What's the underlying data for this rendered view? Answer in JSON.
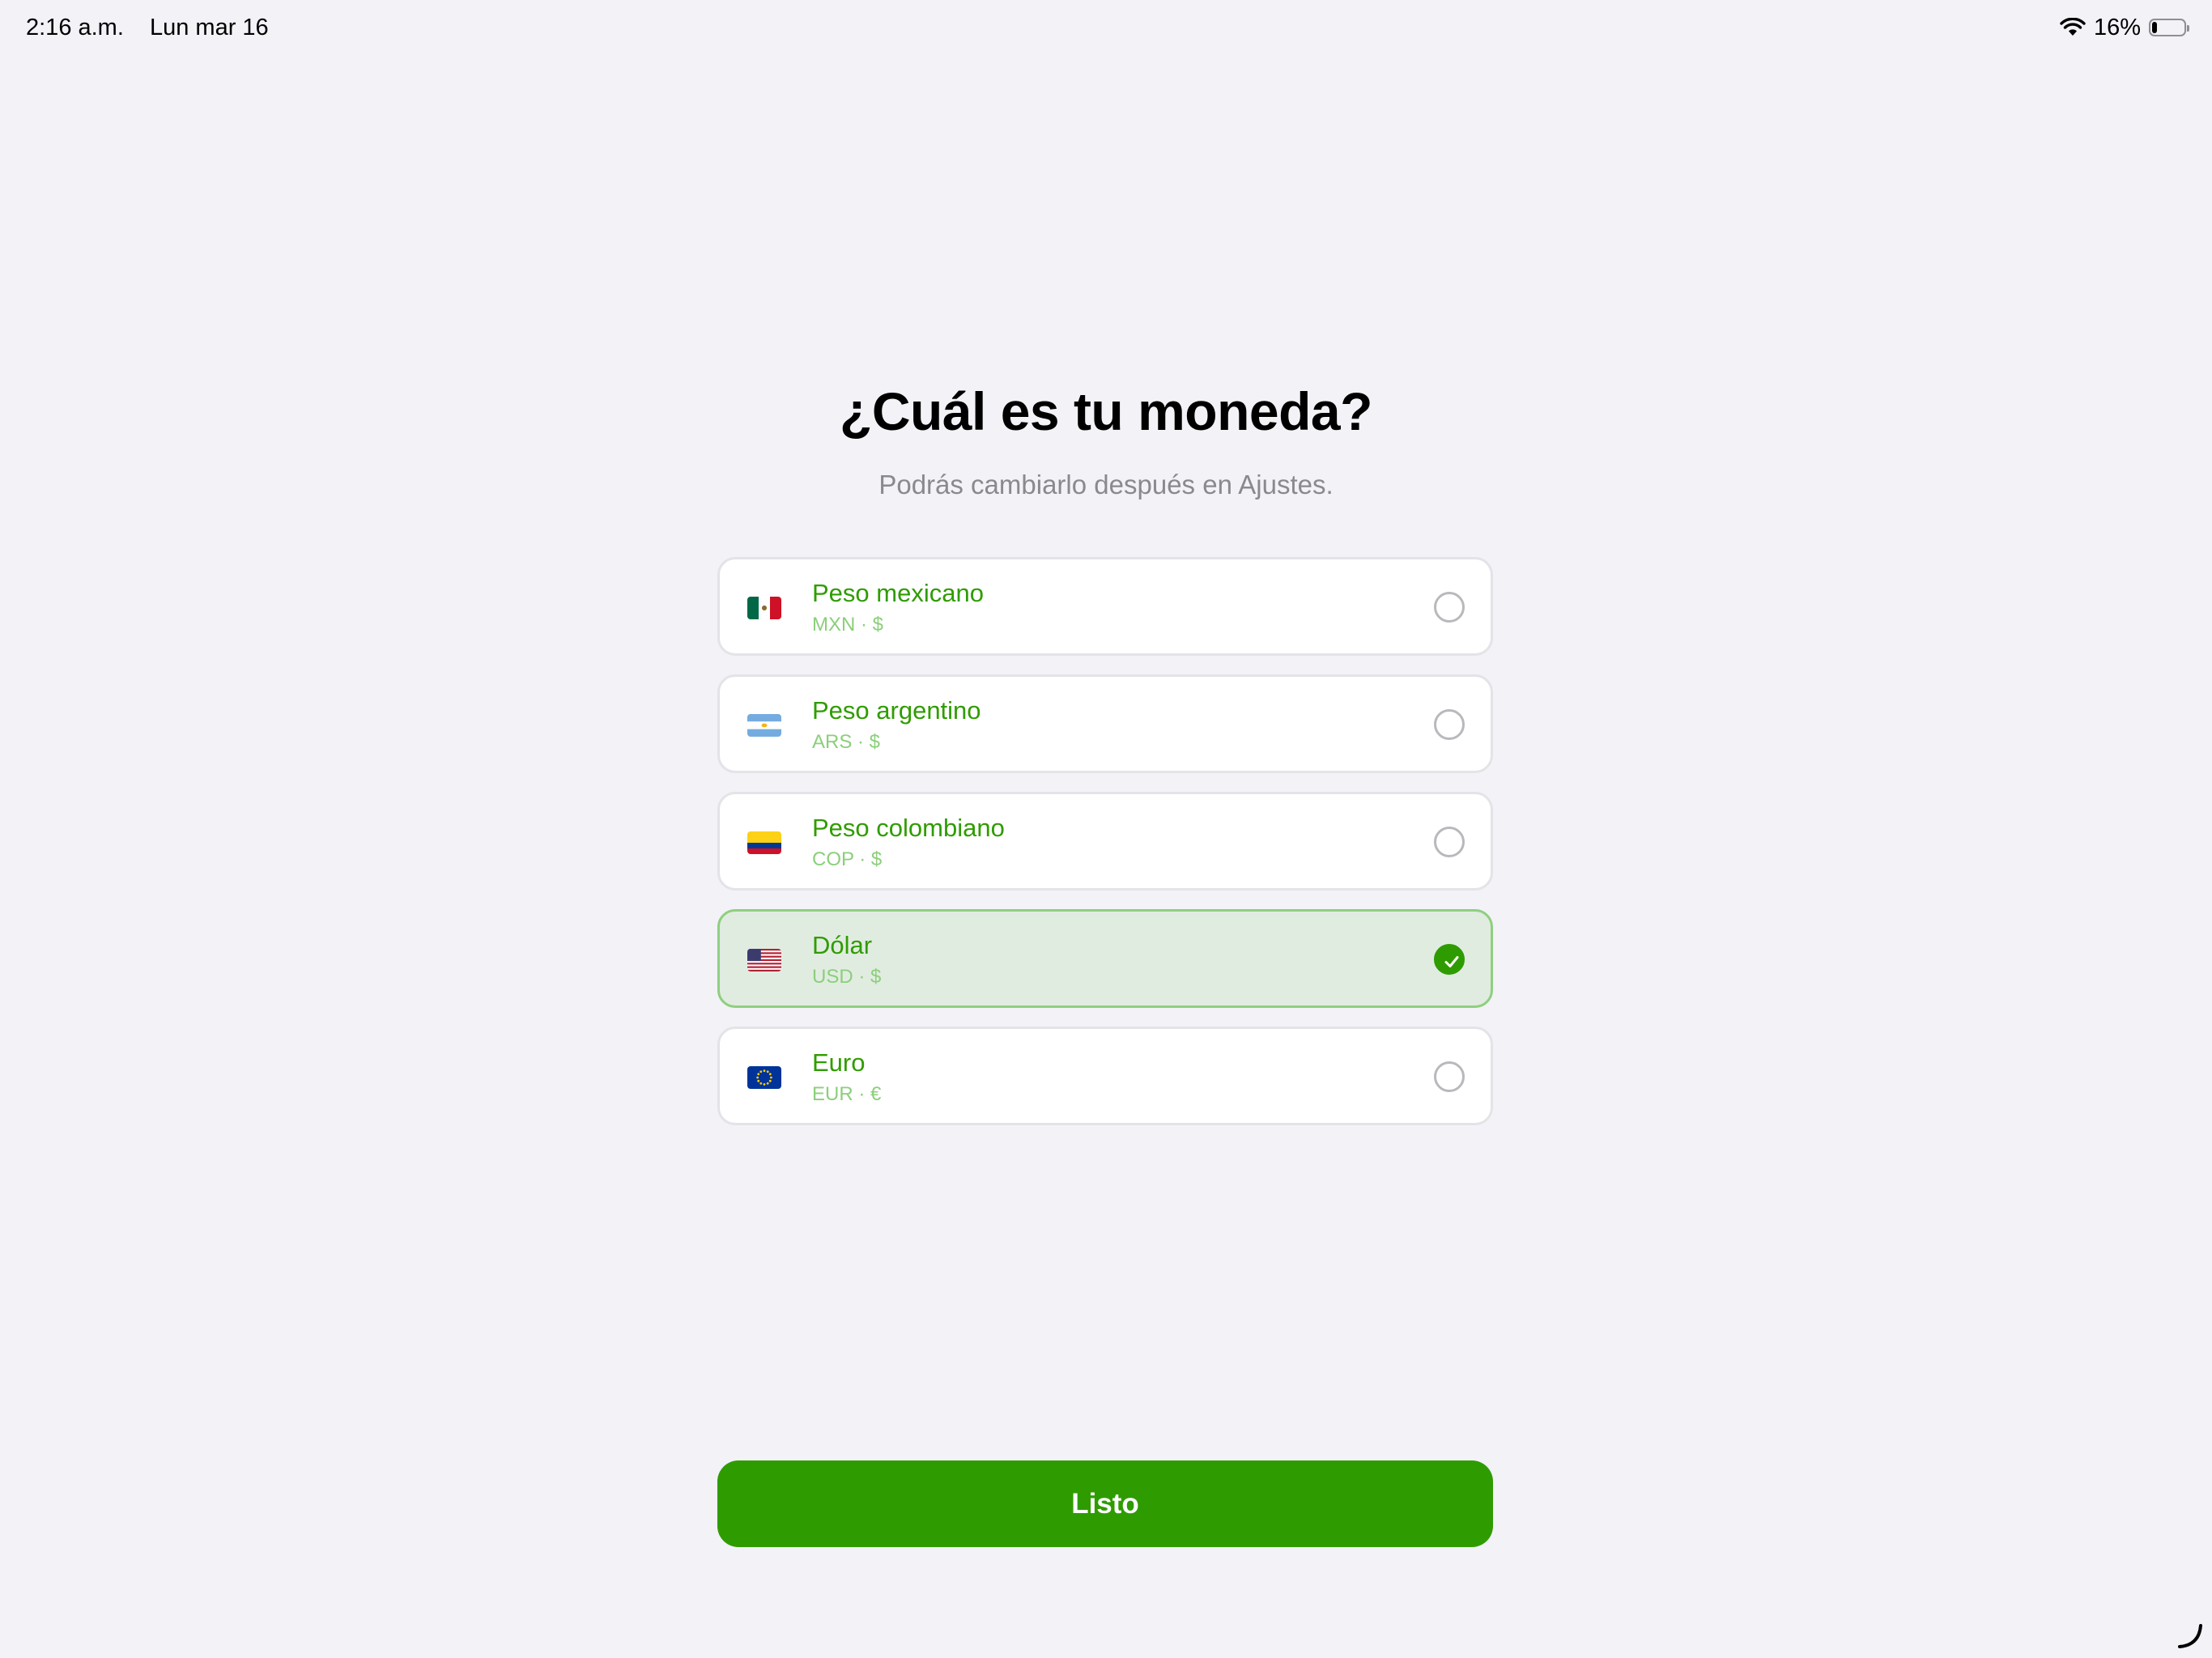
{
  "status_bar": {
    "time": "2:16 a.m.",
    "date": "Lun mar 16",
    "battery": "16%",
    "battery_level": 0.16
  },
  "heading": {
    "title": "¿Cuál es tu moneda?",
    "subtitle": "Podrás cambiarlo después en Ajustes."
  },
  "currencies": [
    {
      "name": "Peso mexicano",
      "code": "MXN · $",
      "flag": "mexico-flag-icon",
      "selected": false
    },
    {
      "name": "Peso argentino",
      "code": "ARS · $",
      "flag": "argentina-flag-icon",
      "selected": false
    },
    {
      "name": "Peso colombiano",
      "code": "COP · $",
      "flag": "colombia-flag-icon",
      "selected": false
    },
    {
      "name": "Dólar",
      "code": "USD · $",
      "flag": "usa-flag-icon",
      "selected": true
    },
    {
      "name": "Euro",
      "code": "EUR · €",
      "flag": "eu-flag-icon",
      "selected": false
    }
  ],
  "done_button": {
    "label": "Listo"
  },
  "colors": {
    "accent": "#2e9c00",
    "background": "#f2f2f7",
    "selected_background": "#e1ece1",
    "selected_border": "#8fcf7f",
    "subtitle": "#8a8a8e"
  }
}
